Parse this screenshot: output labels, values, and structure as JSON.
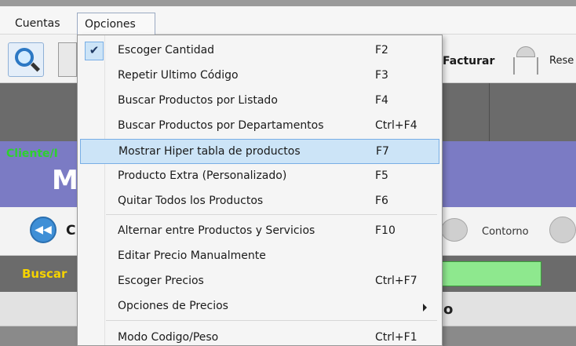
{
  "menubar": {
    "cuentas": "Cuentas",
    "opciones": "Opciones"
  },
  "toolbar": {
    "facturar": "Facturar",
    "rese": "Rese"
  },
  "client": {
    "label": "Cliente/I",
    "big_letter": "M"
  },
  "nav": {
    "c_letter": "C",
    "contorno": "Contorno"
  },
  "search": {
    "label": "Buscar"
  },
  "table_header": {
    "o_letter": "o"
  },
  "dropdown": {
    "items": [
      {
        "label": "Escoger Cantidad",
        "shortcut": "F2"
      },
      {
        "label": "Repetir Ultimo Código",
        "shortcut": "F3"
      },
      {
        "label": "Buscar Productos por Listado",
        "shortcut": "F4"
      },
      {
        "label": "Buscar Productos por Departamentos",
        "shortcut": "Ctrl+F4"
      },
      {
        "label": "Mostrar Hiper tabla de productos",
        "shortcut": "F7"
      },
      {
        "label": "Producto Extra (Personalizado)",
        "shortcut": "F5"
      },
      {
        "label": "Quitar Todos los Productos",
        "shortcut": "F6"
      },
      {
        "label": "Alternar entre  Productos y Servicios",
        "shortcut": "F10"
      },
      {
        "label": "Editar Precio Manualmente",
        "shortcut": ""
      },
      {
        "label": "Escoger Precios",
        "shortcut": "Ctrl+F7"
      },
      {
        "label": "Opciones de Precios",
        "shortcut": ""
      },
      {
        "label": "Modo Codigo/Peso",
        "shortcut": "Ctrl+F1"
      }
    ],
    "checked_index": 0,
    "highlighted_index": 4,
    "submenu_index": 10,
    "check_mark": "✔"
  },
  "colors": {
    "highlight": "#cce4f7",
    "client_panel": "#7b7bc4",
    "client_label": "#2ed12e",
    "search_label": "#f5d300",
    "search_field": "#8ee88e"
  }
}
